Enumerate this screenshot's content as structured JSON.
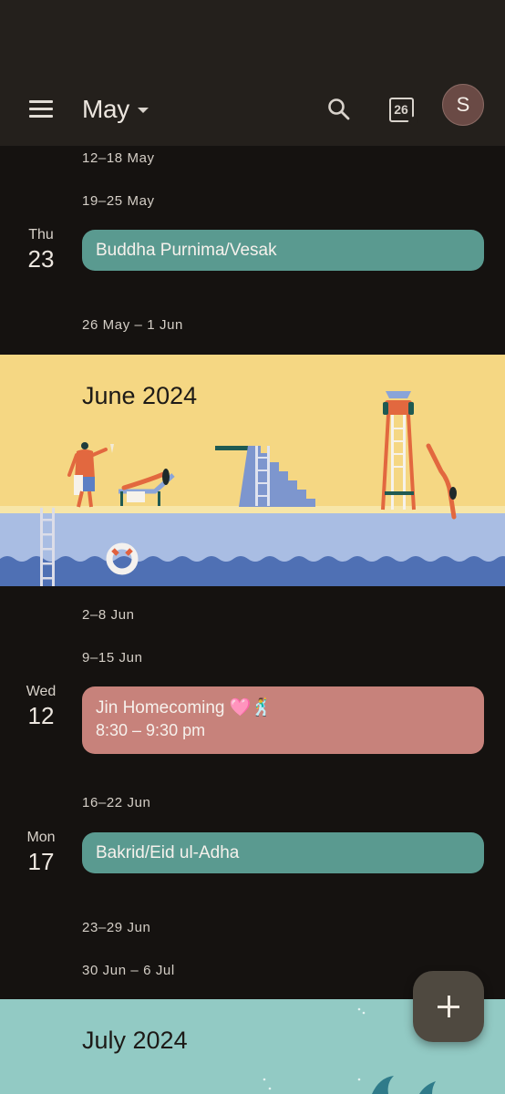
{
  "app_bar": {
    "menu_icon": "hamburger-menu-icon",
    "month": "May",
    "search_icon": "search-icon",
    "today_icon": "calendar-today-icon",
    "today_date": "26",
    "avatar_initial": "S",
    "avatar_color": "#6a4a45"
  },
  "schedule": {
    "weeks_may": [
      "12–18 May",
      "19–25 May",
      "26 May – 1 Jun"
    ],
    "may_events": [
      {
        "day_name": "Thu",
        "day_num": "23",
        "title": "Buddha Purnima/Vesak",
        "color": "#5a9a90"
      }
    ],
    "june_banner": {
      "title": "June 2024",
      "illustration": "pool-summer-illustration"
    },
    "weeks_june": [
      "2–8 Jun",
      "9–15 Jun",
      "16–22 Jun",
      "23–29 Jun",
      "30 Jun – 6 Jul"
    ],
    "june_events": [
      {
        "day_name": "Wed",
        "day_num": "12",
        "title": "Jin Homecoming 🩷🕺",
        "time": "8:30 – 9:30 pm",
        "color": "#c7827b"
      },
      {
        "day_name": "Mon",
        "day_num": "17",
        "title": "Bakrid/Eid ul-Adha",
        "color": "#5a9a90"
      }
    ],
    "july_banner": {
      "title": "July 2024",
      "illustration": "underwater-illustration"
    }
  },
  "fab": {
    "icon": "plus-icon",
    "label": "Create event"
  }
}
